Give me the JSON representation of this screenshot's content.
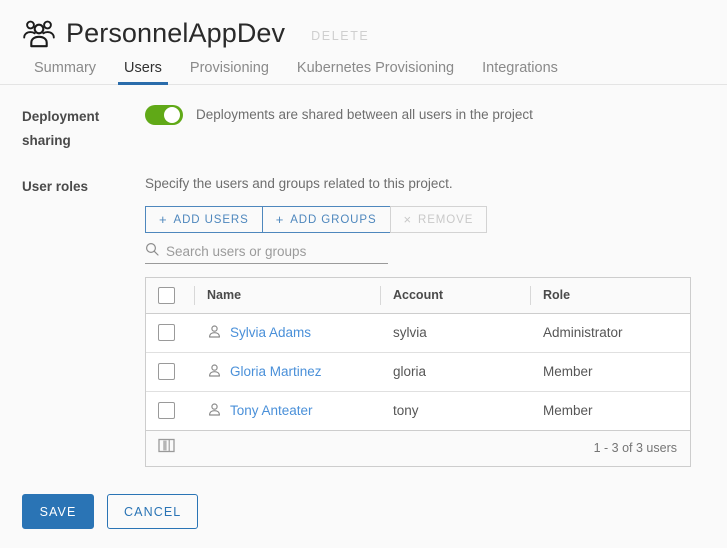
{
  "header": {
    "icon": "group-users-icon",
    "title": "PersonnelAppDev",
    "delete_label": "DELETE"
  },
  "tabs": [
    {
      "label": "Summary",
      "active": false
    },
    {
      "label": "Users",
      "active": true
    },
    {
      "label": "Provisioning",
      "active": false
    },
    {
      "label": "Kubernetes Provisioning",
      "active": false
    },
    {
      "label": "Integrations",
      "active": false
    }
  ],
  "deployment_sharing": {
    "label_line1": "Deployment",
    "label_line2": "sharing",
    "toggle_on": true,
    "toggle_color": "#60a917",
    "description": "Deployments are shared between all users in the project"
  },
  "user_roles": {
    "label": "User roles",
    "helper_text": "Specify the users and groups related to this project.",
    "buttons": {
      "add_users": "+ ADD USERS",
      "add_users_plus": "+",
      "add_users_text": "ADD USERS",
      "add_groups_plus": "+",
      "add_groups_text": "ADD GROUPS",
      "remove_x": "×",
      "remove_text": "REMOVE",
      "remove_disabled": true
    },
    "search": {
      "value": "",
      "placeholder": "Search users or groups",
      "icon": "search-icon"
    }
  },
  "table": {
    "columns": [
      "Name",
      "Account",
      "Role"
    ],
    "rows": [
      {
        "name": "Sylvia Adams",
        "account": "sylvia",
        "role": "Administrator",
        "checked": false
      },
      {
        "name": "Gloria Martinez",
        "account": "gloria",
        "role": "Member",
        "checked": false
      },
      {
        "name": "Tony Anteater",
        "account": "tony",
        "role": "Member",
        "checked": false
      }
    ],
    "footer": {
      "column_picker_icon": "columns-icon",
      "count_text": "1 - 3 of 3 users"
    }
  },
  "actions": {
    "save_label": "SAVE",
    "cancel_label": "CANCEL",
    "primary_color": "#2a74b5"
  }
}
